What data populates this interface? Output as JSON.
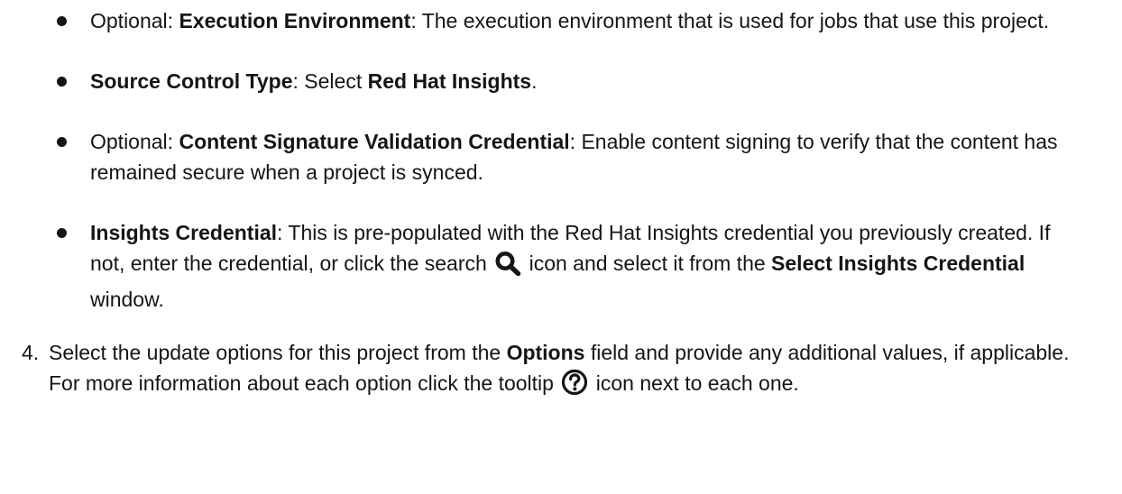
{
  "bullets": [
    {
      "prefix": "Optional: ",
      "term": "Execution Environment",
      "text": ": The execution environment that is used for jobs that use this project."
    },
    {
      "prefix": "",
      "term": "Source Control Type",
      "text": ": Select ",
      "term2": "Red Hat Insights",
      "text2": "."
    },
    {
      "prefix": "Optional: ",
      "term": "Content Signature Validation Credential",
      "text": ": Enable content signing to verify that the content has remained secure when a project is synced."
    },
    {
      "term": "Insights Credential",
      "text_before_icon": ": This is pre-populated with the Red Hat Insights credential you previously created. If not, enter the credential, or click the search ",
      "icon": "search-icon",
      "text_after_icon": " icon and select it from the ",
      "term2": "Select Insights Credential",
      "text2": " window."
    }
  ],
  "step": {
    "number": "4.",
    "text_before": "Select the update options for this project from the ",
    "term": "Options",
    "text_mid": " field and provide any additional values, if applicable. For more information about each option click the tooltip ",
    "icon": "help-circle-icon",
    "text_after": " icon next to each one."
  }
}
